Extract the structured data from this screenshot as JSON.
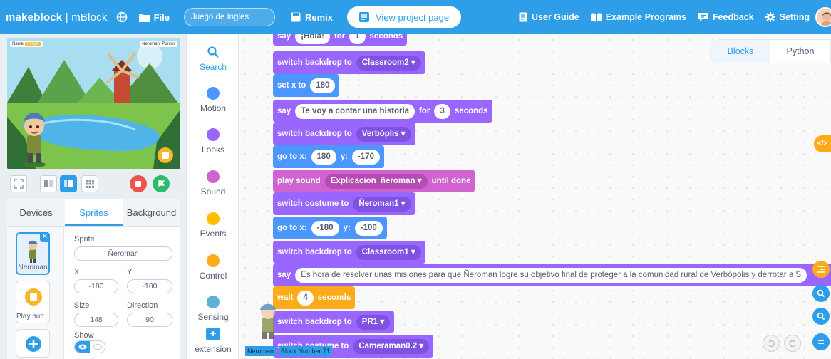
{
  "topbar": {
    "brand_bold": "makeblock",
    "brand_sep": " | ",
    "brand_app": "mBlock",
    "file_label": "File",
    "project_name": "Juego de Ingles",
    "remix_label": "Remix",
    "view_project_label": "View project page",
    "menu": {
      "user_guide": "User Guide",
      "example_programs": "Example Programs",
      "feedback": "Feedback",
      "setting": "Setting"
    },
    "bg_color": "#2f9ee8"
  },
  "stage": {
    "name_label": "Name",
    "name_value": "Felipe",
    "score_label": "Ñeroman: Puntos"
  },
  "tabs": [
    "Devices",
    "Sprites",
    "Background"
  ],
  "active_tab": "Sprites",
  "sprites": [
    {
      "label": "Ñeroman",
      "selected": true
    },
    {
      "label": "Play butt...",
      "selected": false
    }
  ],
  "sprite_props": {
    "sprite_label": "Sprite",
    "sprite_name": "Ñeroman",
    "x_label": "X",
    "y_label": "Y",
    "x": "-180",
    "y": "-100",
    "size_label": "Size",
    "direction_label": "Direction",
    "size": "148",
    "direction": "90",
    "show_label": "Show"
  },
  "categories": [
    {
      "label": "Search",
      "color": "#2f9ee8",
      "icon": "search-icon"
    },
    {
      "label": "Motion",
      "color": "#4c97ff"
    },
    {
      "label": "Looks",
      "color": "#9966ff"
    },
    {
      "label": "Sound",
      "color": "#cf63cf"
    },
    {
      "label": "Events",
      "color": "#ffbf00"
    },
    {
      "label": "Control",
      "color": "#ffab19"
    },
    {
      "label": "Sensing",
      "color": "#5cb1d6"
    },
    {
      "label": "extension",
      "color": "#2f9ee8"
    }
  ],
  "editor_tabs": {
    "blocks": "Blocks",
    "python": "Python"
  },
  "blocks": {
    "b0": {
      "say": "say",
      "msg": "¡Hola!",
      "for": "for",
      "secs": "1",
      "unit": "seconds"
    },
    "b1": {
      "text": "switch backdrop to",
      "value": "Classroom2 ▾"
    },
    "b2": {
      "text": "set x to",
      "value": "180"
    },
    "b3": {
      "say": "say",
      "msg": "Te voy a contar una historia",
      "for": "for",
      "secs": "3",
      "unit": "seconds"
    },
    "b4": {
      "text": "switch backdrop to",
      "value": "Verbóplis ▾"
    },
    "b5": {
      "text": "go to x:",
      "x": "180",
      "ylabel": "y:",
      "y": "-170"
    },
    "b6": {
      "text": "play sound",
      "value": "Explicacion_ñeroman ▾",
      "suffix": "until done"
    },
    "b7": {
      "text": "switch costume to",
      "value": "Ñeroman1 ▾"
    },
    "b8": {
      "text": "go to x:",
      "x": "-180",
      "ylabel": "y:",
      "y": "-100"
    },
    "b9": {
      "text": "switch backdrop to",
      "value": "Classroom1 ▾"
    },
    "b10": {
      "say": "say",
      "msg": "Es hora de resolver unas misiones para que Ñeroman logre su objetivo final de proteger a la comunidad rural de Verbópolis y derrotar a S"
    },
    "b11": {
      "text": "wait",
      "value": "4",
      "unit": "seconds"
    },
    "b12": {
      "text": "switch backdrop to",
      "value": "PR1 ▾"
    },
    "b13": {
      "text": "switch costume to",
      "value": "Cameraman0.2 ▾"
    }
  },
  "status": {
    "sprite": "Ñeroman",
    "block_number": "Block Number:71"
  },
  "colors": {
    "looks": "#9966ff",
    "motion": "#4c97ff",
    "sound": "#cf63cf",
    "control": "#ffab19",
    "accent": "#2f9ee8"
  }
}
